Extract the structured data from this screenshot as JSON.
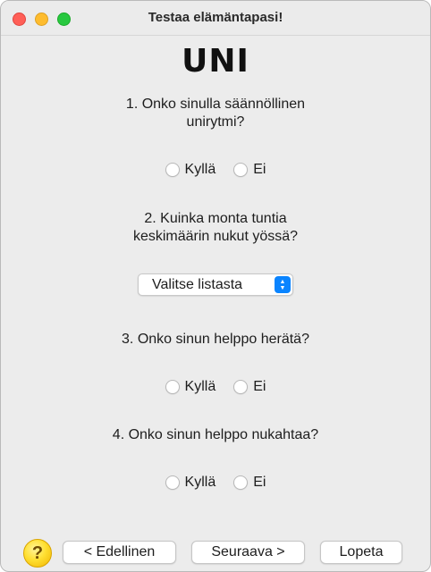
{
  "window": {
    "title": "Testaa elämäntapasi!"
  },
  "heading": "UNI",
  "questions": [
    {
      "line1": "1. Onko sinulla säännöllinen",
      "line2": "unirytmi?",
      "options": [
        "Kyllä",
        "Ei"
      ]
    },
    {
      "line1": "2. Kuinka monta tuntia",
      "line2": "keskimäärin nukut yössä?",
      "select": "Valitse listasta"
    },
    {
      "line1": "3. Onko sinun helppo herätä?",
      "options": [
        "Kyllä",
        "Ei"
      ]
    },
    {
      "line1": "4. Onko sinun helppo nukahtaa?",
      "options": [
        "Kyllä",
        "Ei"
      ]
    }
  ],
  "buttons": {
    "previous": "< Edellinen",
    "next": "Seuraava >",
    "quit": "Lopeta"
  },
  "help_icon": {
    "name": "question-mark-icon",
    "glyph": "?"
  }
}
